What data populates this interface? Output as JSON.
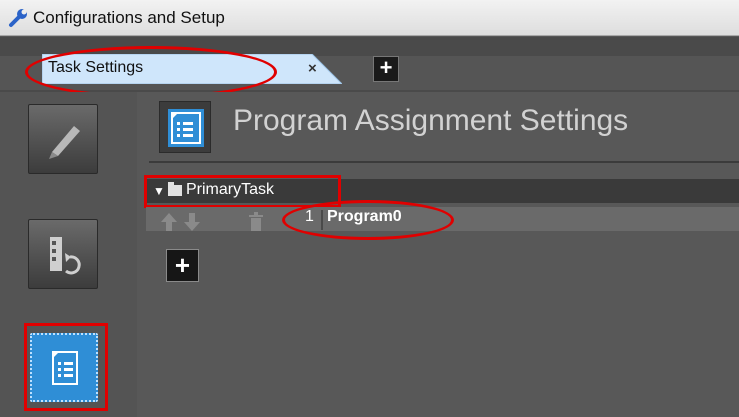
{
  "window": {
    "title": "Configurations and Setup",
    "icon": "wrench-icon"
  },
  "tabs": [
    {
      "label": "Task Settings",
      "close": "×"
    }
  ],
  "add_tab_label": "+",
  "sidebar": {
    "buttons": [
      {
        "name": "edit-pencil-icon"
      },
      {
        "name": "io-refresh-icon"
      },
      {
        "name": "program-assignment-icon",
        "active": true
      }
    ]
  },
  "main": {
    "header_title": "Program Assignment Settings",
    "tasks": [
      {
        "name": "PrimaryTask",
        "expanded": true,
        "programs": [
          {
            "number": "1",
            "name": "Program0"
          }
        ]
      }
    ],
    "add_program_label": "+"
  },
  "colors": {
    "accent": "#2f8ed6",
    "highlight": "#e00000",
    "tab_bg": "#cfe6fb"
  }
}
